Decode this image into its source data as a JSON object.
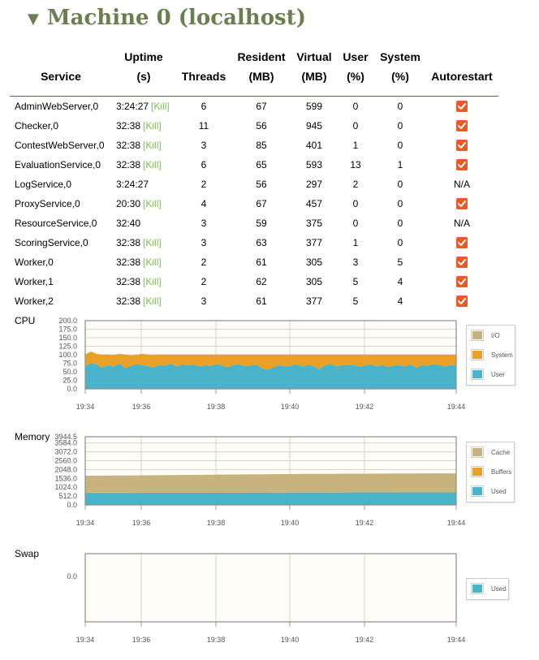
{
  "page": {
    "title": "Machine 0 (localhost)",
    "toggle_icon": "triangle-down-icon"
  },
  "table": {
    "headers": {
      "service": "Service",
      "uptime": [
        "Uptime",
        "(s)"
      ],
      "threads": "Threads",
      "resident": [
        "Resident",
        "(MB)"
      ],
      "virtual": [
        "Virtual",
        "(MB)"
      ],
      "user": [
        "User",
        "(%)"
      ],
      "system": [
        "System",
        "(%)"
      ],
      "autorestart": "Autorestart"
    },
    "kill_label": "[Kill]",
    "na_label": "N/A",
    "rows": [
      {
        "name": "AdminWebServer,0",
        "uptime": "3:24:27",
        "kill": true,
        "threads": "6",
        "resident": "67",
        "virtual": "599",
        "user": "0",
        "system": "0",
        "autorestart": "checked"
      },
      {
        "name": "Checker,0",
        "uptime": "32:38",
        "kill": true,
        "threads": "11",
        "resident": "56",
        "virtual": "945",
        "user": "0",
        "system": "0",
        "autorestart": "checked"
      },
      {
        "name": "ContestWebServer,0",
        "uptime": "32:38",
        "kill": true,
        "threads": "3",
        "resident": "85",
        "virtual": "401",
        "user": "1",
        "system": "0",
        "autorestart": "checked"
      },
      {
        "name": "EvaluationService,0",
        "uptime": "32:38",
        "kill": true,
        "threads": "6",
        "resident": "65",
        "virtual": "593",
        "user": "13",
        "system": "1",
        "autorestart": "checked"
      },
      {
        "name": "LogService,0",
        "uptime": "3:24:27",
        "kill": false,
        "threads": "2",
        "resident": "56",
        "virtual": "297",
        "user": "2",
        "system": "0",
        "autorestart": "na"
      },
      {
        "name": "ProxyService,0",
        "uptime": "20:30",
        "kill": true,
        "threads": "4",
        "resident": "67",
        "virtual": "457",
        "user": "0",
        "system": "0",
        "autorestart": "checked"
      },
      {
        "name": "ResourceService,0",
        "uptime": "32:40",
        "kill": false,
        "threads": "3",
        "resident": "59",
        "virtual": "375",
        "user": "0",
        "system": "0",
        "autorestart": "na"
      },
      {
        "name": "ScoringService,0",
        "uptime": "32:38",
        "kill": true,
        "threads": "3",
        "resident": "63",
        "virtual": "377",
        "user": "1",
        "system": "0",
        "autorestart": "checked"
      },
      {
        "name": "Worker,0",
        "uptime": "32:38",
        "kill": true,
        "threads": "2",
        "resident": "61",
        "virtual": "305",
        "user": "3",
        "system": "5",
        "autorestart": "checked"
      },
      {
        "name": "Worker,1",
        "uptime": "32:38",
        "kill": true,
        "threads": "2",
        "resident": "62",
        "virtual": "305",
        "user": "5",
        "system": "4",
        "autorestart": "checked"
      },
      {
        "name": "Worker,2",
        "uptime": "32:38",
        "kill": true,
        "threads": "3",
        "resident": "61",
        "virtual": "377",
        "user": "5",
        "system": "4",
        "autorestart": "checked"
      }
    ]
  },
  "colors": {
    "title": "#6a7f50",
    "kill_link": "#7ec344",
    "checkbox": "#e85a2a",
    "cpu_user": "#4bb3c9",
    "cpu_system": "#ea9f27",
    "cpu_io": "#c8b37f",
    "mem_used": "#4bb3c9",
    "mem_buffers": "#ea9f27",
    "mem_cache": "#c8b37f",
    "plot_bg": "#fffdf8",
    "grid": "#d9d3c3"
  },
  "chart_data": [
    {
      "type": "area",
      "label": "CPU",
      "x_ticks": [
        "19:34",
        "19:36",
        "19:38",
        "19:40",
        "19:42",
        "19:44"
      ],
      "y_ticks": [
        "0.0",
        "25.0",
        "50.0",
        "75.0",
        "100.0",
        "125.0",
        "150.0",
        "175.0",
        "200.0"
      ],
      "ylim": [
        0,
        200
      ],
      "legend": [
        "I/O",
        "System",
        "User"
      ],
      "legend_position": "right",
      "series": [
        {
          "name": "User",
          "values": [
            68,
            75,
            72,
            62,
            70,
            66,
            74,
            60,
            68,
            72,
            70,
            66,
            63,
            70,
            68,
            74,
            66,
            72,
            69,
            71,
            65,
            70,
            67,
            73,
            68,
            64,
            70,
            72,
            66,
            69,
            71,
            60,
            56,
            64,
            70,
            66,
            68,
            72,
            65,
            70,
            67,
            58,
            70,
            72,
            66,
            70,
            69,
            71,
            65,
            68,
            72,
            66,
            70,
            64,
            68,
            70,
            66,
            72,
            62,
            70,
            68,
            72,
            70,
            66,
            70,
            68
          ]
        },
        {
          "name": "System",
          "values": [
            32,
            34,
            30,
            38,
            30,
            33,
            28,
            40,
            30,
            27,
            32,
            34,
            36,
            30,
            32,
            26,
            34,
            28,
            31,
            29,
            35,
            30,
            33,
            27,
            32,
            36,
            30,
            28,
            34,
            31,
            29,
            40,
            44,
            36,
            30,
            34,
            32,
            28,
            35,
            30,
            33,
            42,
            30,
            28,
            34,
            30,
            31,
            29,
            35,
            32,
            28,
            34,
            30,
            36,
            32,
            30,
            34,
            28,
            38,
            30,
            32,
            28,
            30,
            34,
            30,
            32
          ]
        },
        {
          "name": "I/O",
          "values": [
            1,
            1,
            1,
            1,
            1,
            1,
            1,
            1,
            1,
            1,
            1,
            1,
            1,
            1,
            1,
            1,
            1,
            1,
            1,
            1,
            1,
            1,
            1,
            1,
            1,
            1,
            1,
            1,
            1,
            1,
            1,
            1,
            1,
            1,
            1,
            1,
            1,
            1,
            1,
            1,
            1,
            1,
            1,
            1,
            1,
            1,
            1,
            1,
            1,
            1,
            1,
            1,
            1,
            1,
            1,
            1,
            1,
            1,
            1,
            1,
            1,
            1,
            1,
            1,
            1,
            1
          ]
        }
      ]
    },
    {
      "type": "area",
      "label": "Memory",
      "x_ticks": [
        "19:34",
        "19:36",
        "19:38",
        "19:40",
        "19:42",
        "19:44"
      ],
      "y_ticks": [
        "0.0",
        "512.0",
        "1024.0",
        "1536.0",
        "2048.0",
        "2560.0",
        "3072.0",
        "3584.0",
        "3944.5"
      ],
      "ylim": [
        0,
        3944.5
      ],
      "legend": [
        "Cache",
        "Buffers",
        "Used"
      ],
      "legend_position": "right",
      "series": [
        {
          "name": "Used",
          "values": [
            700,
            700,
            700,
            700,
            705,
            705,
            705,
            710,
            710,
            710,
            712,
            715,
            715,
            718,
            720,
            720,
            722,
            722,
            725,
            725,
            726,
            728,
            728,
            730,
            730,
            730
          ]
        },
        {
          "name": "Buffers",
          "values": [
            15,
            15,
            15,
            15,
            15,
            15,
            15,
            15,
            15,
            15,
            15,
            15,
            15,
            15,
            15,
            15,
            15,
            15,
            15,
            15,
            15,
            15,
            15,
            15,
            15,
            15
          ]
        },
        {
          "name": "Cache",
          "values": [
            975,
            980,
            985,
            990,
            995,
            1000,
            1010,
            1015,
            1020,
            1030,
            1035,
            1040,
            1045,
            1050,
            1055,
            1060,
            1062,
            1065,
            1068,
            1070,
            1072,
            1075,
            1076,
            1078,
            1080,
            1080
          ]
        }
      ]
    },
    {
      "type": "area",
      "label": "Swap",
      "x_ticks": [
        "19:34",
        "19:36",
        "19:38",
        "19:40",
        "19:42",
        "19:44"
      ],
      "y_ticks": [
        "0.0"
      ],
      "legend": [
        "Used"
      ],
      "legend_position": "right",
      "series": [
        {
          "name": "Used",
          "values": [
            0,
            0,
            0,
            0,
            0,
            0,
            0,
            0,
            0,
            0,
            0,
            0
          ]
        }
      ]
    }
  ]
}
